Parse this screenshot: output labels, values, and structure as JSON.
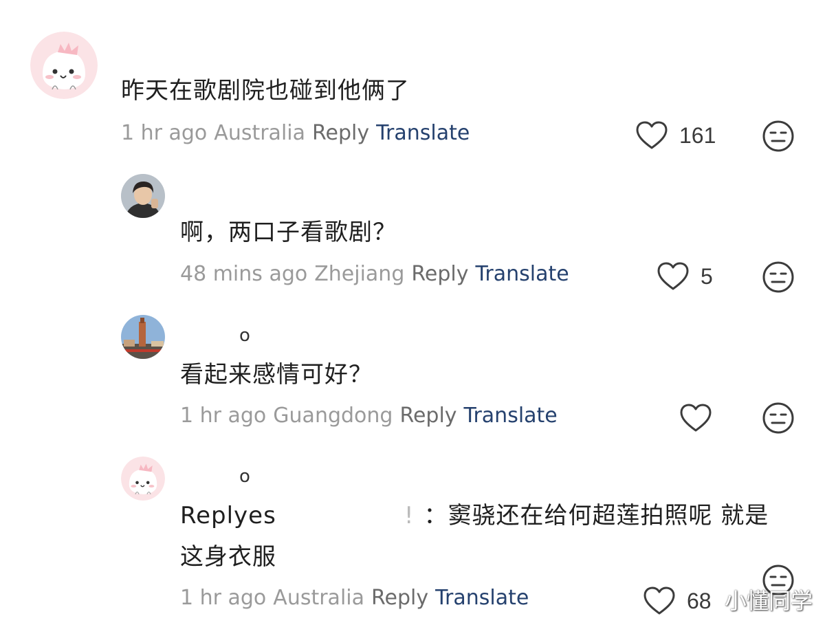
{
  "comments": [
    {
      "text": "昨天在歌剧院也碰到他俩了",
      "time": "1 hr ago",
      "region": "Australia",
      "reply_label": "Reply",
      "translate_label": "Translate",
      "likes": "161",
      "avatar": "pink-dino-avatar"
    },
    {
      "text": "啊，两口子看歌剧？",
      "time": "48 mins ago",
      "region": "Zhejiang",
      "reply_label": "Reply",
      "translate_label": "Translate",
      "likes": "5",
      "avatar": "young-man-photo-avatar"
    },
    {
      "username": "o",
      "text": "看起来感情可好？",
      "time": "1 hr ago",
      "region": "Guangdong",
      "reply_label": "Reply",
      "translate_label": "Translate",
      "likes": "",
      "avatar": "tower-photo-avatar"
    },
    {
      "username": "o",
      "reply_prefix": "Reply",
      "reply_target": "es",
      "exclaim": "!",
      "text_line1": "：窦骁还在给何超莲拍照呢 就是",
      "text_line2": "这身衣服",
      "time": "1 hr ago",
      "region": "Australia",
      "reply_label": "Reply",
      "translate_label": "Translate",
      "likes": "68",
      "avatar": "pink-dino-avatar"
    }
  ],
  "icons": {
    "like": "heart-outline-icon",
    "dislike": "meh-face-icon"
  },
  "colors": {
    "translate": "#25416e",
    "meta": "#9a9a9a",
    "reply": "#6b6b6b",
    "icon": "#3c3c3c"
  },
  "watermark": "小懂同学"
}
